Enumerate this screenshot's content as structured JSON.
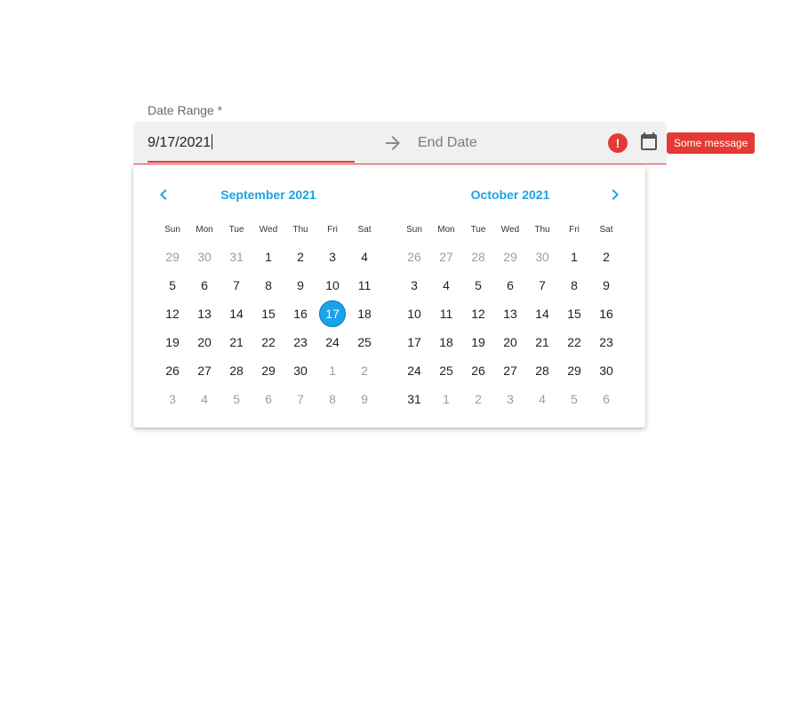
{
  "field": {
    "label": "Date Range *",
    "start_value": "9/17/2021",
    "end_placeholder": "End Date",
    "error_glyph": "!",
    "error_tooltip": "Some message"
  },
  "colors": {
    "accent": "#1aa3e8",
    "error": "#e53935",
    "field_bg": "#f0f0f0"
  },
  "icons": {
    "arrow": "arrow-right-icon",
    "error": "error-icon",
    "calendar": "calendar-icon",
    "prev": "chevron-left-icon",
    "next": "chevron-right-icon"
  },
  "calendar": {
    "weekdays": [
      "Sun",
      "Mon",
      "Tue",
      "Wed",
      "Thu",
      "Fri",
      "Sat"
    ],
    "months": [
      {
        "title": "September 2021",
        "days": [
          {
            "d": "29",
            "m": true
          },
          {
            "d": "30",
            "m": true
          },
          {
            "d": "31",
            "m": true
          },
          {
            "d": "1"
          },
          {
            "d": "2"
          },
          {
            "d": "3"
          },
          {
            "d": "4"
          },
          {
            "d": "5"
          },
          {
            "d": "6"
          },
          {
            "d": "7"
          },
          {
            "d": "8"
          },
          {
            "d": "9"
          },
          {
            "d": "10"
          },
          {
            "d": "11"
          },
          {
            "d": "12"
          },
          {
            "d": "13"
          },
          {
            "d": "14"
          },
          {
            "d": "15"
          },
          {
            "d": "16"
          },
          {
            "d": "17",
            "sel": true
          },
          {
            "d": "18"
          },
          {
            "d": "19"
          },
          {
            "d": "20"
          },
          {
            "d": "21"
          },
          {
            "d": "22"
          },
          {
            "d": "23"
          },
          {
            "d": "24"
          },
          {
            "d": "25"
          },
          {
            "d": "26"
          },
          {
            "d": "27"
          },
          {
            "d": "28"
          },
          {
            "d": "29"
          },
          {
            "d": "30"
          },
          {
            "d": "1",
            "m": true
          },
          {
            "d": "2",
            "m": true
          },
          {
            "d": "3",
            "m": true
          },
          {
            "d": "4",
            "m": true
          },
          {
            "d": "5",
            "m": true
          },
          {
            "d": "6",
            "m": true
          },
          {
            "d": "7",
            "m": true
          },
          {
            "d": "8",
            "m": true
          },
          {
            "d": "9",
            "m": true
          }
        ]
      },
      {
        "title": "October 2021",
        "days": [
          {
            "d": "26",
            "m": true
          },
          {
            "d": "27",
            "m": true
          },
          {
            "d": "28",
            "m": true
          },
          {
            "d": "29",
            "m": true
          },
          {
            "d": "30",
            "m": true
          },
          {
            "d": "1"
          },
          {
            "d": "2"
          },
          {
            "d": "3"
          },
          {
            "d": "4"
          },
          {
            "d": "5"
          },
          {
            "d": "6"
          },
          {
            "d": "7"
          },
          {
            "d": "8"
          },
          {
            "d": "9"
          },
          {
            "d": "10"
          },
          {
            "d": "11"
          },
          {
            "d": "12"
          },
          {
            "d": "13"
          },
          {
            "d": "14"
          },
          {
            "d": "15"
          },
          {
            "d": "16"
          },
          {
            "d": "17"
          },
          {
            "d": "18"
          },
          {
            "d": "19"
          },
          {
            "d": "20"
          },
          {
            "d": "21"
          },
          {
            "d": "22"
          },
          {
            "d": "23"
          },
          {
            "d": "24"
          },
          {
            "d": "25"
          },
          {
            "d": "26"
          },
          {
            "d": "27"
          },
          {
            "d": "28"
          },
          {
            "d": "29"
          },
          {
            "d": "30"
          },
          {
            "d": "31"
          },
          {
            "d": "1",
            "m": true
          },
          {
            "d": "2",
            "m": true
          },
          {
            "d": "3",
            "m": true
          },
          {
            "d": "4",
            "m": true
          },
          {
            "d": "5",
            "m": true
          },
          {
            "d": "6",
            "m": true
          }
        ]
      }
    ]
  }
}
